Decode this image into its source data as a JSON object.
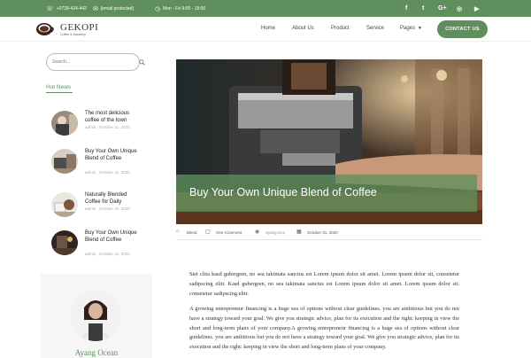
{
  "topbar": {
    "phone": "+0728-424-442",
    "email": "[email protected]",
    "hours": "Mon - Fri 9:00 - 18:00",
    "social": [
      "facebook-icon",
      "twitter-icon",
      "google-plus-icon",
      "instagram-icon",
      "youtube-icon"
    ],
    "social_glyphs": [
      "f",
      "t",
      "G+",
      "◎",
      "▶"
    ]
  },
  "brand": {
    "name": "GEKOPI",
    "tagline": "Coffee & Academy"
  },
  "nav": {
    "home": "Home",
    "about": "About Us",
    "product": "Product",
    "service": "Service",
    "pages": "Pages",
    "contact": "CONTACT US"
  },
  "sidebar": {
    "search_placeholder": "Search...",
    "hot_news_title": "Hot News",
    "news": [
      {
        "title": "The most delicious coffee of the town",
        "meta": "admin , October 31, 2020"
      },
      {
        "title": "Buy Your Own Unique Blend of Coffee",
        "meta": "admin , October 31, 2020"
      },
      {
        "title": "Naturally Blended Coffee for Daily",
        "meta": "admin , October 31, 2020"
      },
      {
        "title": "Buy Your Own Unique Blend of Coffee",
        "meta": "admin , October 31, 2020"
      }
    ],
    "author_name": "Ayang Ocean"
  },
  "post": {
    "title": "Buy Your Own Unique Blend of Coffee",
    "tag": "Blend",
    "comments": "One Comment",
    "author": "Ayang Oco",
    "date": "October 31, 2020",
    "paragraphs": [
      "Stet clita kasd gubergren, no sea takimata sanctus est Lorem ipsum dolor sit amet. Lorem ipsum dolor sit, consetetur sadipscing elitr. Kasd gubergren, no sea takimata sanctus est Lorem ipsum dolor sit amet. Lorem ipsum dolor sit. consetetur sadipscing elitr.",
      "A growing entrepreneur financing is a huge sea of options without clear guidelines. you are ambitious but you do not have a strategy toward your goal. We give you strategic advice, plan for its execution and the right: keeping in view the short and long-term plans of your company.A growing entrepreneur financing is a huge sea of options without clear guidelines. you are ambitious but you do not have a strategy toward your goal. We give you strategic advice, plan for its execution and the right: keeping in view the short and long-term plans of your company."
    ]
  },
  "colors": {
    "brand_green": "#5f8f5c",
    "text": "#333333"
  }
}
